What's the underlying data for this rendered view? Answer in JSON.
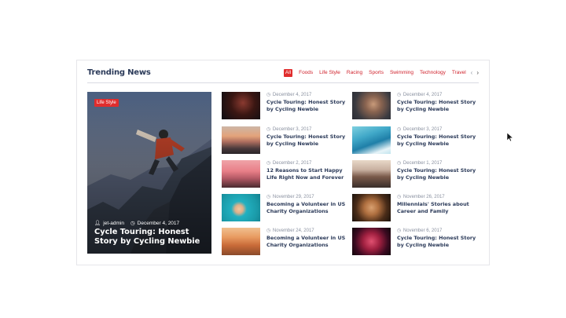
{
  "widget": {
    "title": "Trending News",
    "filters": [
      "All",
      "Foods",
      "Life Style",
      "Racing",
      "Sports",
      "Swimming",
      "Technology",
      "Travel"
    ],
    "active_filter": "All",
    "prev_arrow": "‹",
    "next_arrow": "›"
  },
  "featured": {
    "category": "Life Style",
    "author": "jet-admin",
    "date": "December 4, 2017",
    "title": "Cycle Touring: Honest Story by Cycling Newbie"
  },
  "items": [
    {
      "date": "December 4, 2017",
      "title": "Cycle Touring: Honest Story by Cycling Newbie",
      "thumb": "dark-red-portrait"
    },
    {
      "date": "December 4, 2017",
      "title": "Cycle Touring: Honest Story by Cycling Newbie",
      "thumb": "man-portrait"
    },
    {
      "date": "December 3, 2017",
      "title": "Cycle Touring: Honest Story by Cycling Newbie",
      "thumb": "sunset-road"
    },
    {
      "date": "December 3, 2017",
      "title": "Cycle Touring: Honest Story by Cycling Newbie",
      "thumb": "surfer-wave"
    },
    {
      "date": "December 2, 2017",
      "title": "12 Reasons to Start Happy Life Right Now and Forever",
      "thumb": "pink-sunset"
    },
    {
      "date": "December 1, 2017",
      "title": "Cycle Touring: Honest Story by Cycling Newbie",
      "thumb": "hiker-mountain"
    },
    {
      "date": "November 29, 2017",
      "title": "Becoming a Volunteer in US Charity Organizations",
      "thumb": "pool-swimmer"
    },
    {
      "date": "November 26, 2017",
      "title": "Millennials' Stories about Career and Family",
      "thumb": "woman-portrait"
    },
    {
      "date": "November 24, 2017",
      "title": "Becoming a Volunteer in US Charity Organizations",
      "thumb": "desert-riders"
    },
    {
      "date": "November 6, 2017",
      "title": "Cycle Touring: Honest Story by Cycling Newbie",
      "thumb": "neon-portrait"
    }
  ],
  "colors": {
    "accent": "#e02d2d",
    "title": "#2b3a59",
    "meta": "#8a91a0"
  }
}
